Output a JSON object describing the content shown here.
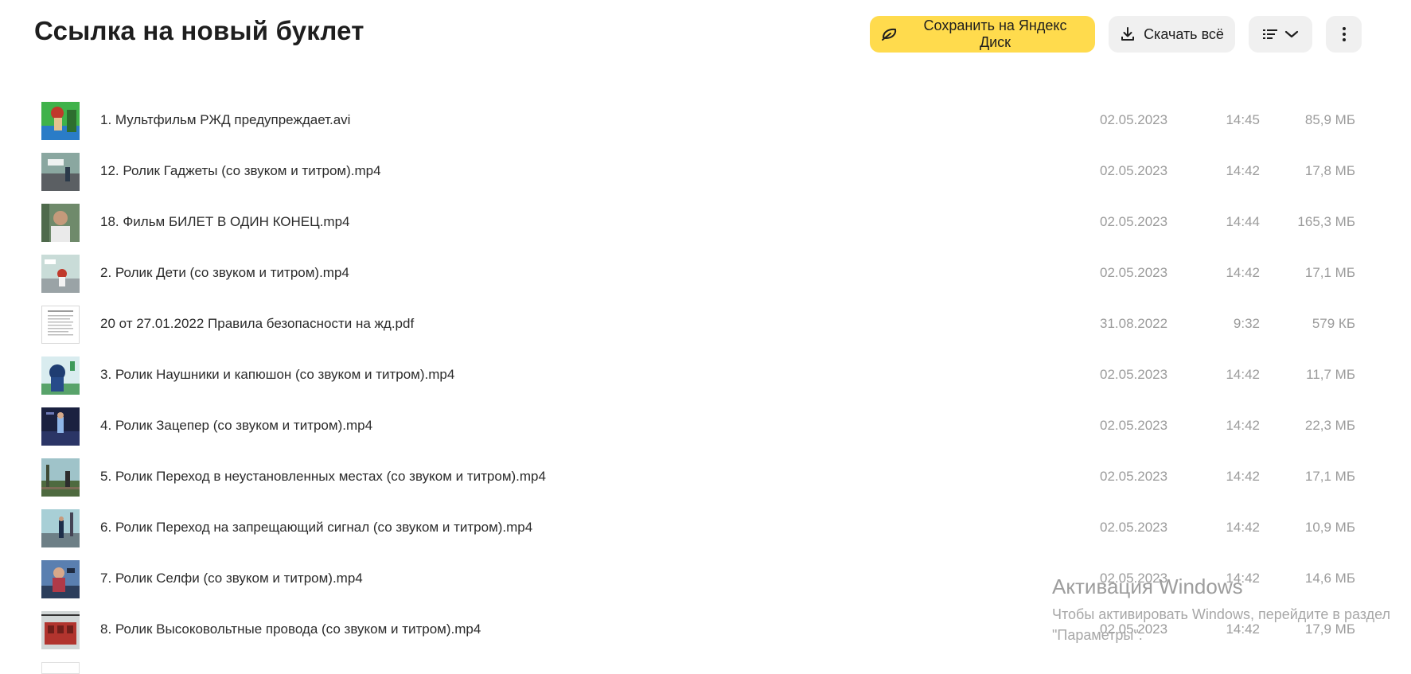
{
  "header": {
    "title": "Ссылка на новый буклет",
    "save_label": "Сохранить на Яндекс Диск",
    "download_label": "Скачать всё",
    "view_icon": "list-view-icon",
    "more_icon": "more-vertical-icon"
  },
  "colors": {
    "accent_yellow": "#ffdb4d",
    "button_gray": "#f0f0f0",
    "meta_text": "#9b9b9b"
  },
  "files": [
    {
      "name": "1. Мультфильм РЖД предупреждает.avi",
      "date": "02.05.2023",
      "time": "14:45",
      "size": "85,9 МБ"
    },
    {
      "name": "12. Ролик Гаджеты (со звуком и титром).mp4",
      "date": "02.05.2023",
      "time": "14:42",
      "size": "17,8 МБ"
    },
    {
      "name": "18. Фильм БИЛЕТ В ОДИН КОНЕЦ.mp4",
      "date": "02.05.2023",
      "time": "14:44",
      "size": "165,3 МБ"
    },
    {
      "name": "2. Ролик Дети (со звуком и титром).mp4",
      "date": "02.05.2023",
      "time": "14:42",
      "size": "17,1 МБ"
    },
    {
      "name": "20 от 27.01.2022 Правила безопасности на жд.pdf",
      "date": "31.08.2022",
      "time": "9:32",
      "size": "579 КБ"
    },
    {
      "name": "3. Ролик Наушники и капюшон (со звуком и титром).mp4",
      "date": "02.05.2023",
      "time": "14:42",
      "size": "11,7 МБ"
    },
    {
      "name": "4. Ролик Зацепер (со звуком и титром).mp4",
      "date": "02.05.2023",
      "time": "14:42",
      "size": "22,3 МБ"
    },
    {
      "name": "5. Ролик Переход в неустановленных местах (со звуком и титром).mp4",
      "date": "02.05.2023",
      "time": "14:42",
      "size": "17,1 МБ"
    },
    {
      "name": "6. Ролик Переход на запрещающий сигнал (со звуком и титром).mp4",
      "date": "02.05.2023",
      "time": "14:42",
      "size": "10,9 МБ"
    },
    {
      "name": "7. Ролик Селфи (со звуком и титром).mp4",
      "date": "02.05.2023",
      "time": "14:42",
      "size": "14,6 МБ"
    },
    {
      "name": "8. Ролик Высоковольтные провода (со звуком и титром).mp4",
      "date": "02.05.2023",
      "time": "14:42",
      "size": "17,9 МБ"
    }
  ],
  "watermark": {
    "title": "Активация Windows",
    "line1": "Чтобы активировать Windows, перейдите в раздел",
    "line2": "\"Параметры\"."
  }
}
